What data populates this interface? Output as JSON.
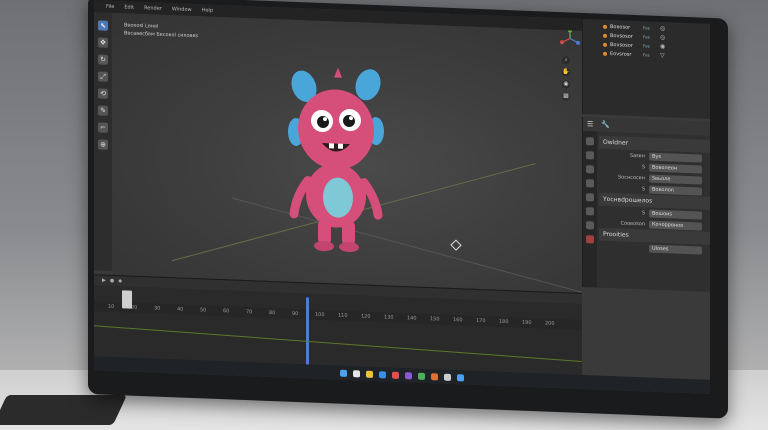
{
  "menubar": {
    "items": [
      "File",
      "Edit",
      "Render",
      "Window",
      "Help"
    ]
  },
  "toolbar": {
    "tools": [
      {
        "icon": "select-cursor-icon",
        "glyph": "⬉"
      },
      {
        "icon": "move-icon",
        "glyph": "✥"
      },
      {
        "icon": "rotate-icon",
        "glyph": "↻"
      },
      {
        "icon": "scale-icon",
        "glyph": "⤢"
      },
      {
        "icon": "transform-icon",
        "glyph": "⟲"
      },
      {
        "icon": "annotate-icon",
        "glyph": "✎"
      },
      {
        "icon": "measure-icon",
        "glyph": "⌐"
      },
      {
        "icon": "cursor-icon",
        "glyph": "⊕"
      }
    ]
  },
  "viewport": {
    "info_line1": "Bвоxоsl Lвнвl",
    "info_line2": "Bвсавесбвм Бвсовоl сиховвs"
  },
  "outliner": {
    "rows": [
      {
        "name": "Bовоsоr",
        "type": "Fвs"
      },
      {
        "name": "Bovsosor",
        "type": "Fвs"
      },
      {
        "name": "Bovsosor",
        "type": "Fвs"
      },
      {
        "name": "Eovsrosr",
        "type": "Fвs"
      }
    ]
  },
  "properties": {
    "panel1_title": "Owldner",
    "rows1": [
      {
        "label": "Sаsвн",
        "value": "Вуs"
      },
      {
        "label": "S",
        "value": "Bоволеон"
      },
      {
        "label": "Sоснсосвн",
        "value": "Sвьолe"
      },
      {
        "label": "S",
        "value": "Bоволоn"
      }
    ],
    "panel2_title": "Yоснвdрошелоs",
    "rows2": [
      {
        "label": "S",
        "value": "Bошоиs"
      },
      {
        "label": "Cоовоsоn",
        "value": "Кочоррвнов"
      }
    ],
    "panel3_title": "Prooities",
    "panel3_item": "Ulоses"
  },
  "timeline": {
    "ticks": [
      "10",
      "20",
      "30",
      "40",
      "50",
      "60",
      "70",
      "80",
      "90",
      "100",
      "110",
      "120",
      "130",
      "140",
      "150",
      "160",
      "170",
      "180",
      "190",
      "200"
    ]
  },
  "taskbar": {
    "icon_colors": [
      "#4aa3f0",
      "#e6e6e6",
      "#f0c040",
      "#3a8ee6",
      "#e05050",
      "#8a5ad6",
      "#50b060",
      "#e07030",
      "#cccccc",
      "#4aa3f0"
    ]
  },
  "colors": {
    "character_body": "#d64f7a",
    "character_ears": "#4aa6d8",
    "character_belly": "#7fc9d6",
    "accent_blue": "#4f7bd0"
  }
}
